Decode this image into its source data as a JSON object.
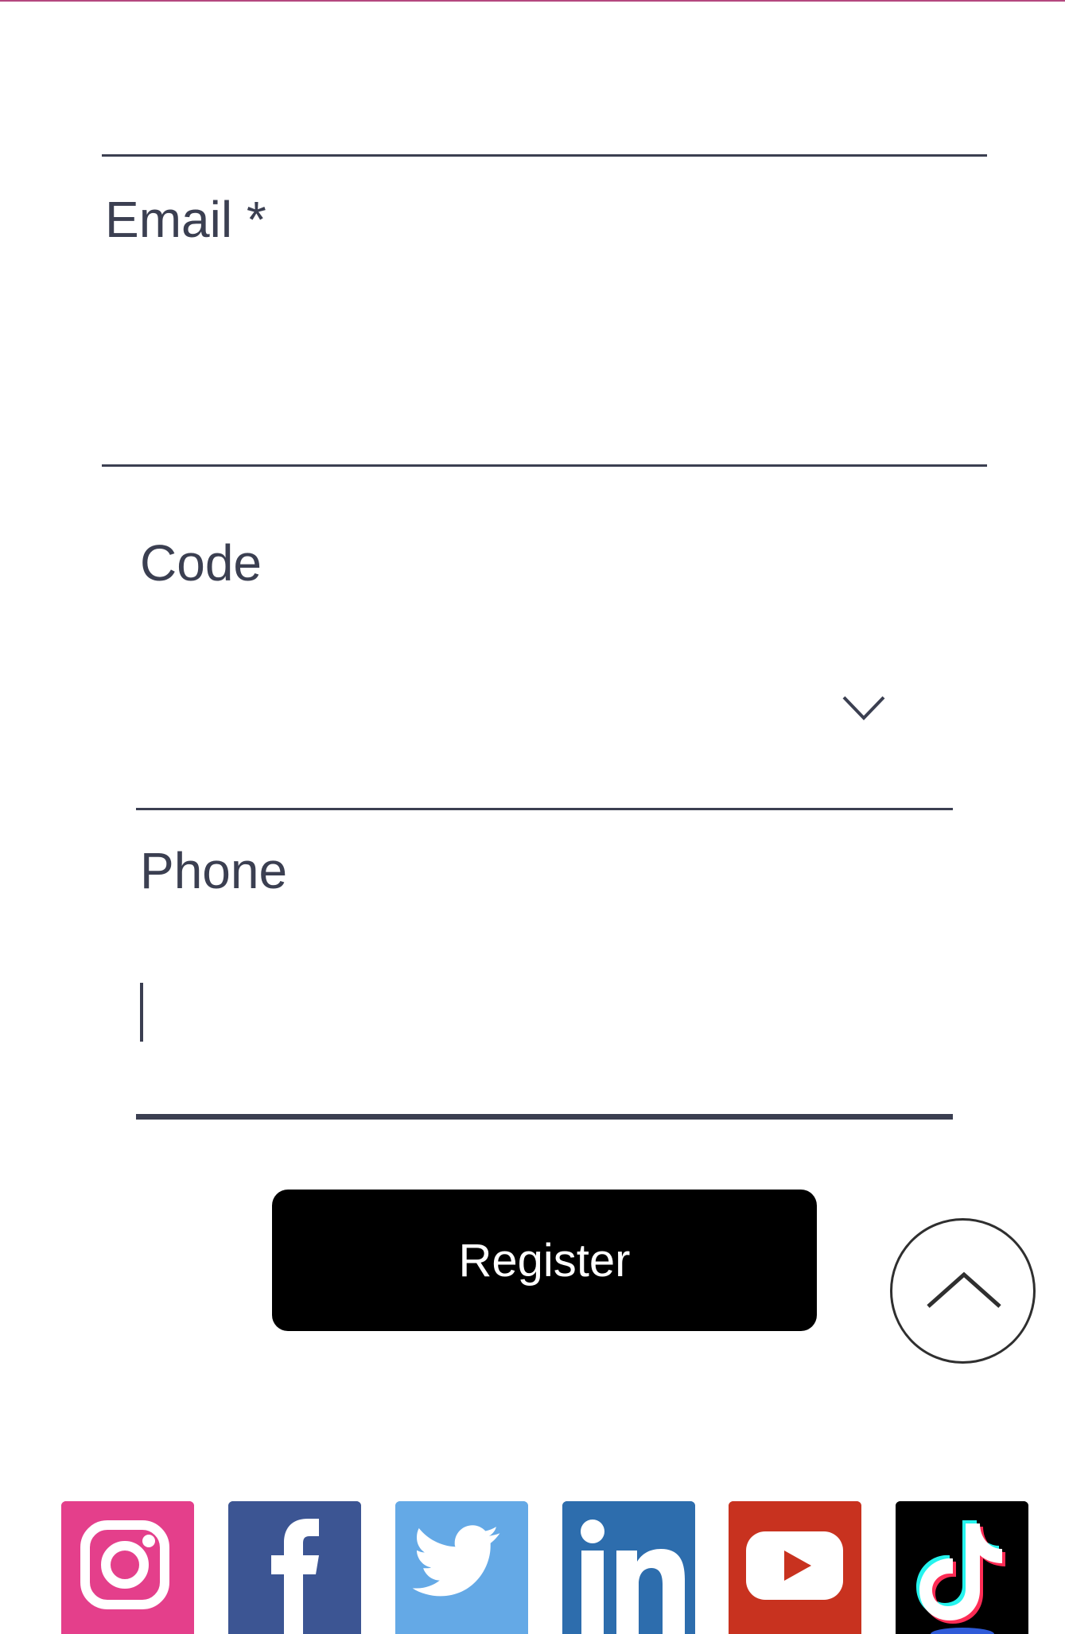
{
  "form": {
    "email": {
      "label": "Email *",
      "value": ""
    },
    "code": {
      "label": "Code",
      "value": ""
    },
    "phone": {
      "label": "Phone",
      "value": ""
    },
    "register_label": "Register"
  },
  "social": [
    {
      "name": "instagram",
      "color": "#e43f8b"
    },
    {
      "name": "facebook",
      "color": "#3c5593"
    },
    {
      "name": "twitter",
      "color": "#64a9e6"
    },
    {
      "name": "linkedin",
      "color": "#2d6dad"
    },
    {
      "name": "youtube",
      "color": "#c8321f"
    },
    {
      "name": "tiktok",
      "color": "#000000"
    }
  ],
  "colors": {
    "accent_top_border": "#b4487f",
    "field_text": "#3b3f51",
    "button_bg": "#000000"
  }
}
